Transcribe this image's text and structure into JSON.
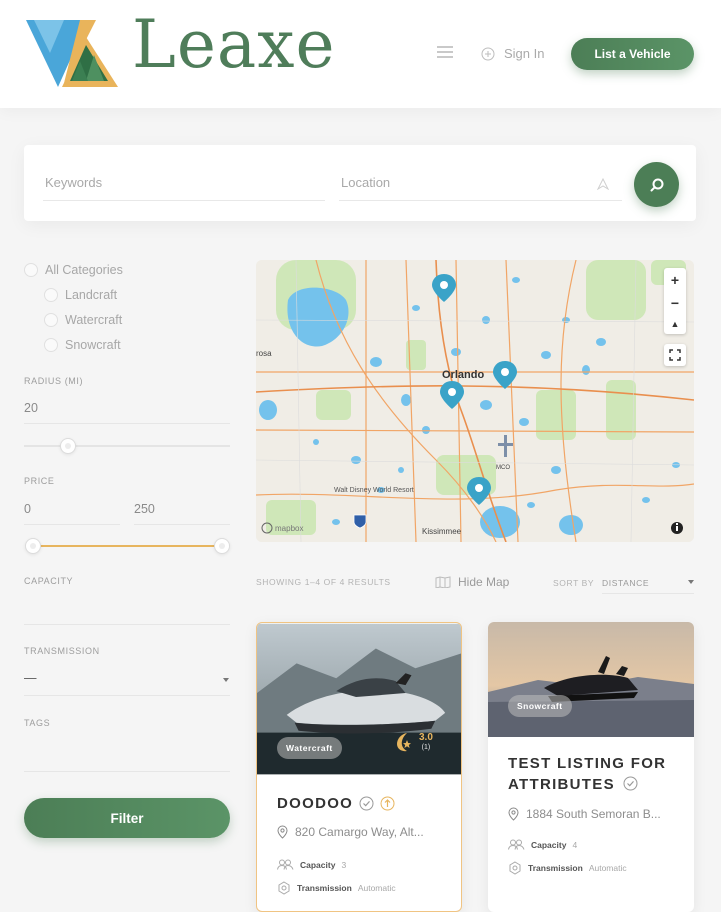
{
  "brand": {
    "name": "Leaxe",
    "color": "#4f7d5a",
    "accent": "#e7b55e"
  },
  "header": {
    "sign_in": "Sign In",
    "list_vehicle": "List a Vehicle"
  },
  "search": {
    "keywords_placeholder": "Keywords",
    "location_placeholder": "Location"
  },
  "filters": {
    "categories": [
      {
        "label": "All Categories"
      },
      {
        "label": "Landcraft"
      },
      {
        "label": "Watercraft"
      },
      {
        "label": "Snowcraft"
      }
    ],
    "radius": {
      "label": "Radius (mi)",
      "value": "20"
    },
    "price": {
      "label": "Price",
      "min": "0",
      "max": "250"
    },
    "capacity": {
      "label": "Capacity"
    },
    "transmission": {
      "label": "Transmission",
      "value": "—"
    },
    "tags": {
      "label": "Tags"
    },
    "button": "Filter"
  },
  "map": {
    "labels": {
      "orlando": "Orlando",
      "kissimmee": "Kissimmee",
      "disney": "Walt Disney World Resort",
      "west": "rosa",
      "airport": "MCO",
      "attrib": "mapbox"
    }
  },
  "results": {
    "showing": "Showing 1–4 of 4 results",
    "hide_map": "Hide Map",
    "sort_label": "Sort by",
    "sort_value": "Distance"
  },
  "listings": [
    {
      "title": "DOODOO",
      "category": "Watercraft",
      "rating": "3.0",
      "reviews": "(1)",
      "address": "820 Camargo Way, Alt...",
      "capacity_label": "Capacity",
      "capacity": "3",
      "transmission_label": "Transmission",
      "transmission": "Automatic"
    },
    {
      "title": "TEST LISTING FOR ATTRIBUTES",
      "category": "Snowcraft",
      "address": "1884 South Semoran B...",
      "capacity_label": "Capacity",
      "capacity": "4",
      "transmission_label": "Transmission",
      "transmission": "Automatic"
    }
  ]
}
